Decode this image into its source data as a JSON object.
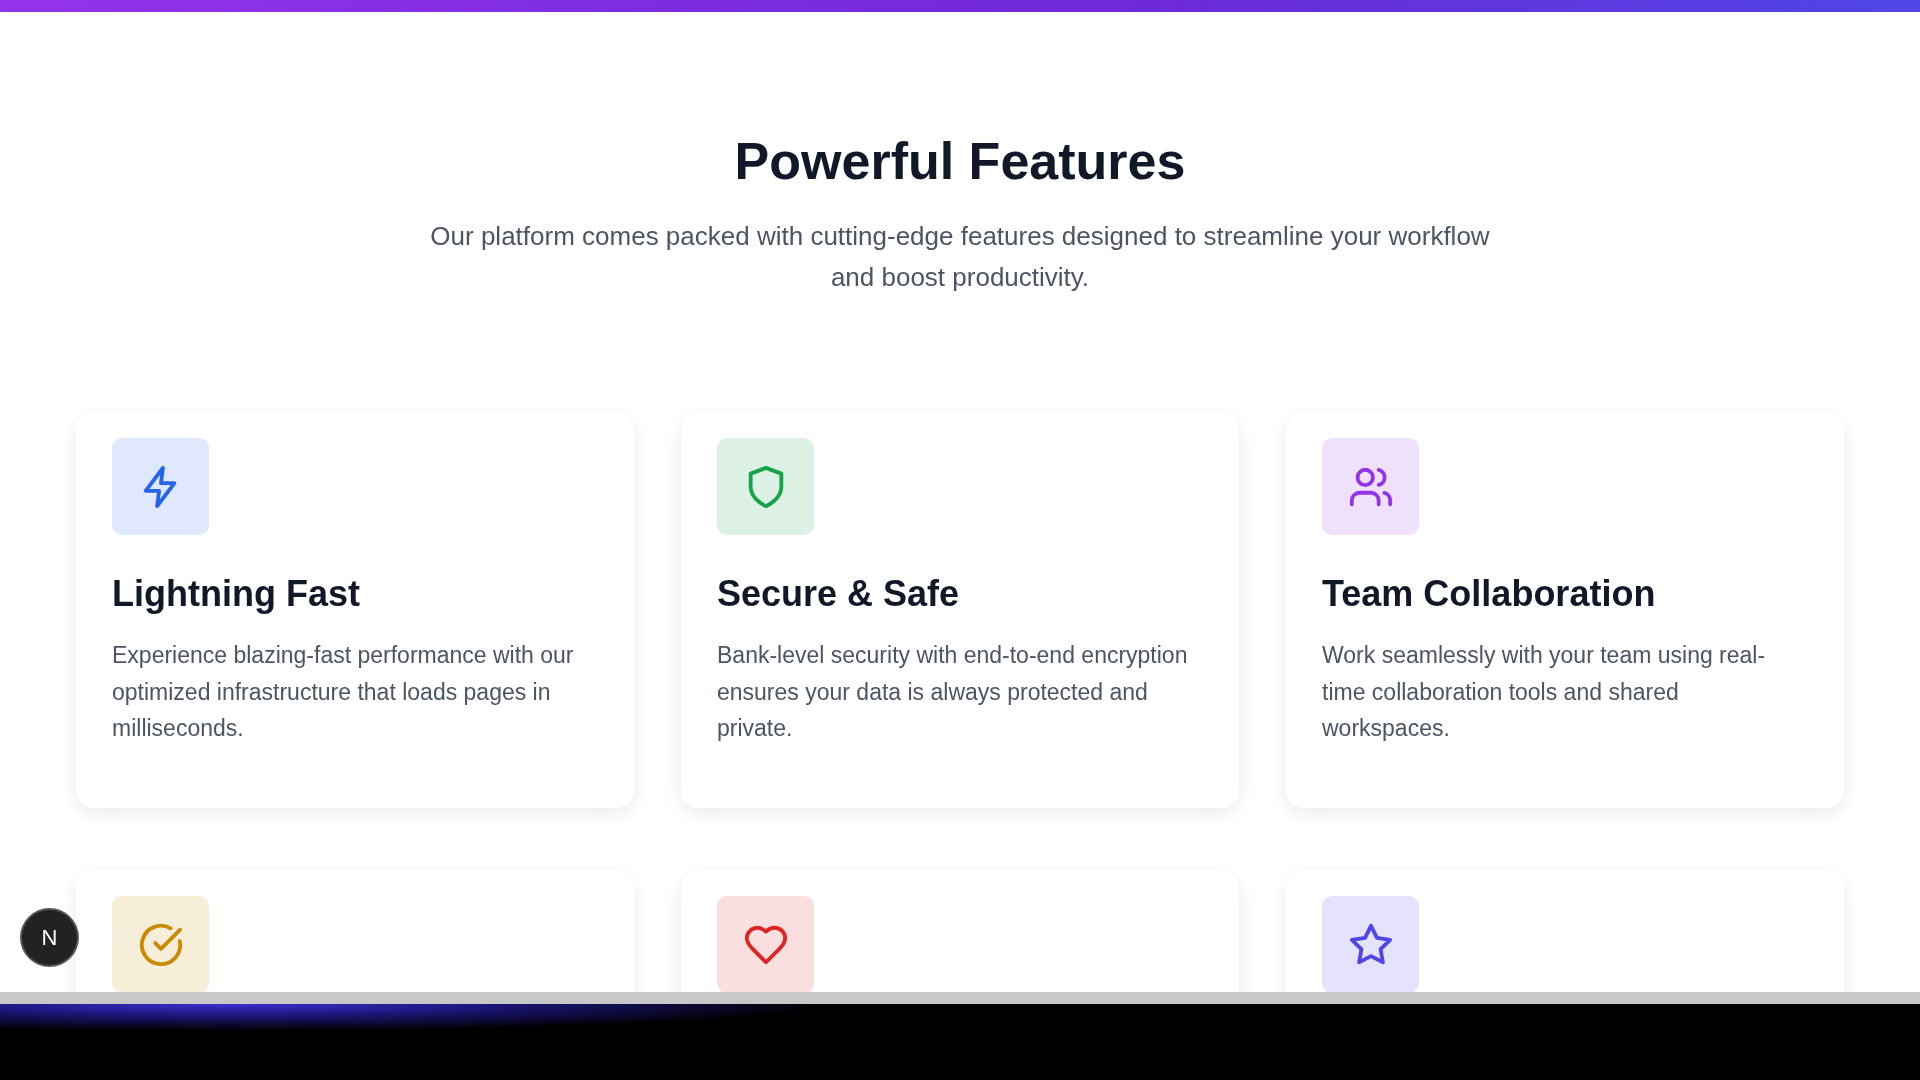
{
  "section": {
    "title": "Powerful Features",
    "subtitle": "Our platform comes packed with cutting-edge features designed to streamline your workflow and boost productivity."
  },
  "features": [
    {
      "title": "Lightning Fast",
      "description": "Experience blazing-fast performance with our optimized infrastructure that loads pages in milliseconds.",
      "color": "#2563eb"
    },
    {
      "title": "Secure & Safe",
      "description": "Bank-level security with end-to-end encryption ensures your data is always protected and private.",
      "color": "#16a34a"
    },
    {
      "title": "Team Collaboration",
      "description": "Work seamlessly with your team using real-time collaboration tools and shared workspaces.",
      "color": "#9333ea"
    },
    {
      "color": "#ca8a04"
    },
    {
      "color": "#dc2626"
    },
    {
      "color": "#4f46e5"
    }
  ],
  "dev_badge": {
    "label": "N"
  }
}
